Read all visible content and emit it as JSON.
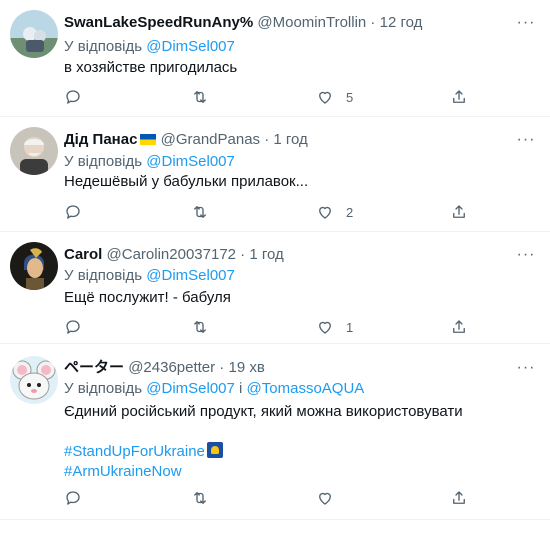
{
  "tweets": [
    {
      "name": "SwanLakeSpeedRunAny%",
      "handle": "@MoominTrollin",
      "sep": " · ",
      "time": "12 год",
      "reply_prefix": "У відповідь ",
      "reply_to_1": "@DimSel007",
      "text": "в хозяйстве пригодилась",
      "like_count": "5"
    },
    {
      "name": "Дід Панас",
      "handle": "@GrandPanas",
      "sep": " · ",
      "time": "1 год",
      "reply_prefix": "У відповідь ",
      "reply_to_1": "@DimSel007",
      "text": "Недешёвый у бабульки прилавок...",
      "like_count": "2"
    },
    {
      "name": "Carol",
      "handle": "@Carolin20037172",
      "sep": " · ",
      "time": "1 год",
      "reply_prefix": "У відповідь ",
      "reply_to_1": "@DimSel007",
      "text": "Ещё послужит! - бабуля",
      "like_count": "1"
    },
    {
      "name": "ペーター",
      "handle": "@2436petter",
      "sep": " · ",
      "time": "19 хв",
      "reply_prefix": "У відповідь ",
      "reply_to_1": "@DimSel007",
      "reply_joiner": " і ",
      "reply_to_2": "@TomassoAQUA",
      "text": "Єдиний російський продукт, який можна використовувати",
      "hashtag_1": "#StandUpForUkraine",
      "hashtag_2": "#ArmUkraineNow",
      "like_count": ""
    }
  ],
  "more_label": "···",
  "icons": [
    "reply-icon",
    "retweet-icon",
    "like-icon",
    "share-icon",
    "more-icon"
  ],
  "colors": {
    "link": "#1d9bf0",
    "muted": "#536471",
    "text": "#0f1419",
    "divider": "#eff3f4"
  }
}
